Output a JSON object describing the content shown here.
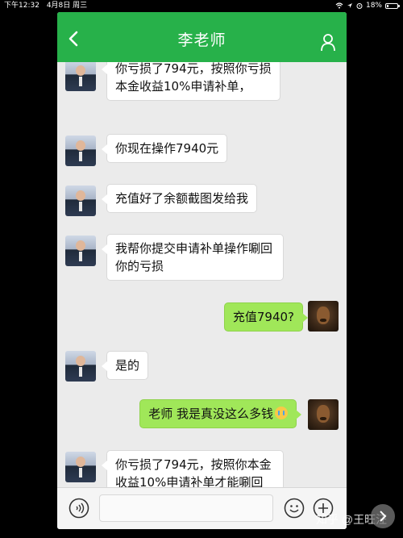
{
  "statusbar": {
    "time": "下午12:32",
    "date": "4月8日 周三",
    "battery_text": "18%",
    "battery_level": 0.18
  },
  "navbar": {
    "title": "李老师",
    "back_icon": "chevron-left-icon",
    "profile_icon": "user-icon"
  },
  "messages": [
    {
      "sender": "teacher",
      "text": "你亏损了794元，按照你亏损本金收益10%申请补单，",
      "partial": true
    },
    {
      "sender": "teacher",
      "text": "你现在操作7940元"
    },
    {
      "sender": "teacher",
      "text": "充值好了余额截图发给我"
    },
    {
      "sender": "teacher",
      "text": "我帮你提交申请补单操作唰回你的亏损"
    },
    {
      "sender": "me",
      "text": "充值7940?"
    },
    {
      "sender": "teacher",
      "text": "是的"
    },
    {
      "sender": "me",
      "text": "老师 我是真没这么多钱",
      "emoji": "crying-face-icon"
    },
    {
      "sender": "teacher",
      "text": "你亏损了794元，按照你本金收益10%申请补单才能唰回"
    }
  ],
  "inputbar": {
    "voice_icon": "voice-icon",
    "input_value": "",
    "emoji_icon": "smiley-icon",
    "plus_icon": "plus-icon"
  },
  "watermark": "知乎 @王旺汪",
  "colors": {
    "nav_green": "#27b14a",
    "chat_bg": "#ebebeb",
    "my_bubble": "#a0e759",
    "their_bubble": "#ffffff"
  }
}
